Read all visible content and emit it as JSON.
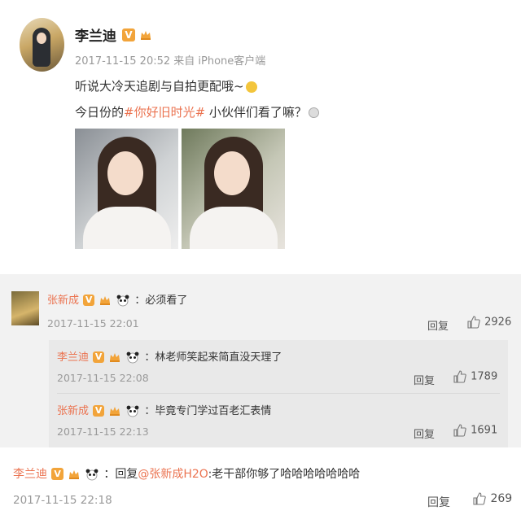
{
  "post": {
    "author": "李兰迪",
    "meta": "2017-11-15 20:52 来自 iPhone客户端",
    "line1": "听说大冷天追剧与自拍更配哦~",
    "line2_prefix": "今日份的",
    "line2_tag": "#你好旧时光#",
    "line2_suffix": " 小伙伴们看了嘛？"
  },
  "comments": [
    {
      "name": "张新成",
      "text": "：必须看了",
      "time": "2017-11-15 22:01",
      "reply_label": "回复",
      "likes": "2926"
    }
  ],
  "replies": [
    {
      "name": "李兰迪",
      "text": "：林老师笑起来简直没天理了",
      "time": "2017-11-15 22:08",
      "reply_label": "回复",
      "likes": "1789"
    },
    {
      "name": "张新成",
      "text": "：毕竟专门学过百老汇表情",
      "time": "2017-11-15 22:13",
      "reply_label": "回复",
      "likes": "1691"
    }
  ],
  "bottom": {
    "name": "李兰迪",
    "text_prefix": "：回复",
    "mention": "@张新成H2O",
    "text_suffix": ":老干部你够了哈哈哈哈哈哈哈",
    "time": "2017-11-15 22:18",
    "reply_label": "回复",
    "likes": "269"
  },
  "icons": {
    "verified": "V",
    "colors": {
      "accent": "#eb7350",
      "badge": "#f2a43a",
      "meta": "#999999"
    }
  }
}
